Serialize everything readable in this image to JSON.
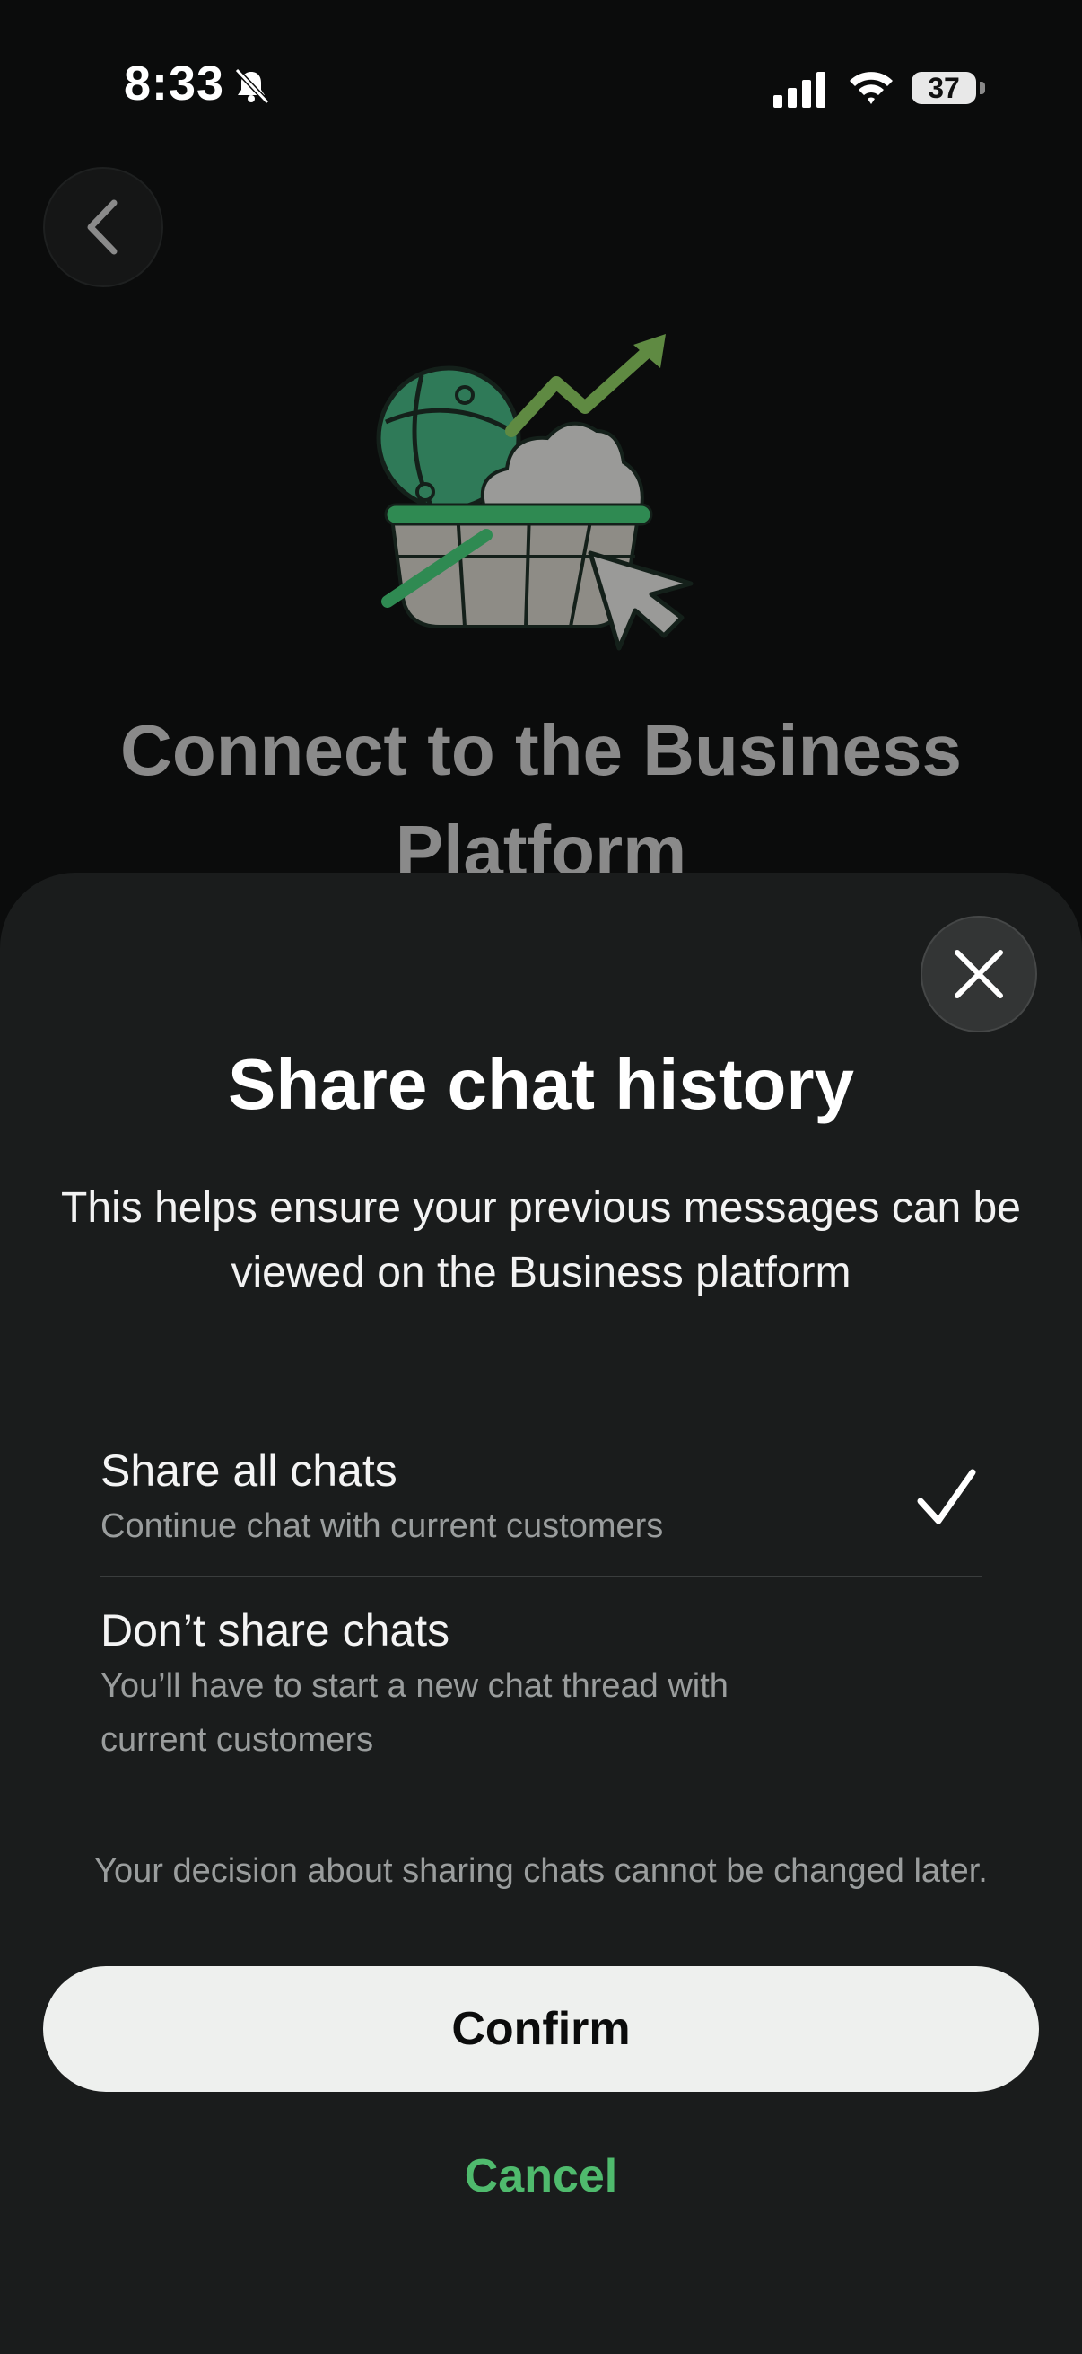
{
  "status_bar": {
    "time": "8:33",
    "battery": "37"
  },
  "background": {
    "title": "Connect to the Business Platform"
  },
  "sheet": {
    "title": "Share chat history",
    "description": "This helps ensure your previous messages can be viewed on the Business platform",
    "options": [
      {
        "title": "Share all chats",
        "subtitle": "Continue chat with current customers",
        "selected": true
      },
      {
        "title": "Don’t share chats",
        "subtitle": "You’ll have to start a new chat thread with current customers",
        "selected": false
      }
    ],
    "note": "Your decision about sharing chats cannot be changed later.",
    "confirm_label": "Confirm",
    "cancel_label": "Cancel"
  },
  "icons": {
    "status": [
      "bell-slash-icon",
      "signal-icon",
      "wifi-icon",
      "battery-icon"
    ],
    "back": "chevron-left-icon",
    "close": "close-icon",
    "check": "checkmark-icon"
  },
  "colors": {
    "accent": "#4fba6d",
    "sheet_bg": "#1a1c1c",
    "confirm_bg": "#eef0ee"
  }
}
